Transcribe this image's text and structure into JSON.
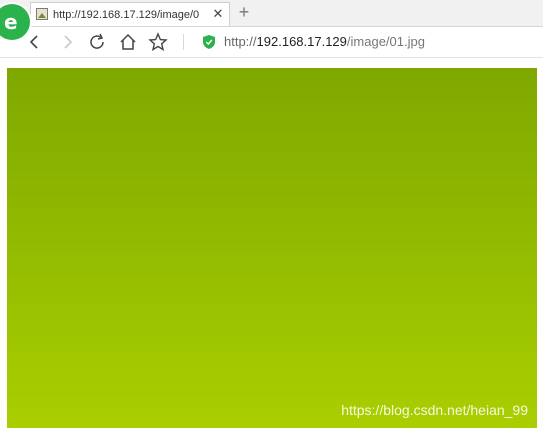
{
  "tab": {
    "title": "http://192.168.17.129/image/0",
    "close_icon": "close-icon",
    "favicon": "image-favicon-icon"
  },
  "new_tab_icon": "plus-icon",
  "browser_logo_icon": "browser-logo-icon",
  "toolbar": {
    "back_icon": "back-chevron-icon",
    "forward_icon": "forward-chevron-icon",
    "reload_icon": "reload-icon",
    "home_icon": "home-icon",
    "bookmark_icon": "star-icon",
    "secure_icon": "shield-icon"
  },
  "address": {
    "prefix": "http://",
    "host": "192.168.17.129",
    "path": "/image/01.jpg"
  },
  "image": {
    "watermark": "https://blog.csdn.net/heian_99",
    "colors": {
      "top": "#7fa800",
      "bottom": "#a9cf00"
    }
  }
}
